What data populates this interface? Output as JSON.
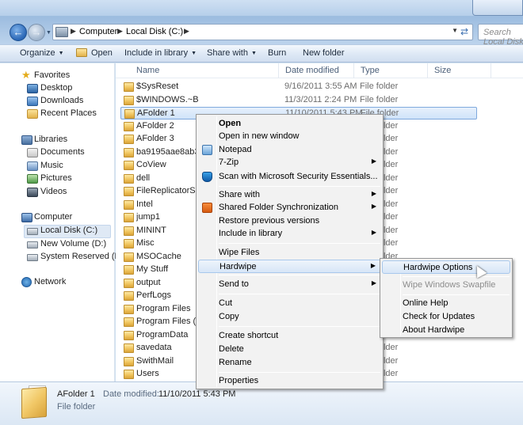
{
  "nav": {
    "address_segments": [
      "Computer",
      "Local Disk (C:)"
    ],
    "search_placeholder": "Search Local Disk (C:)"
  },
  "toolbar": {
    "organize": "Organize",
    "open": "Open",
    "include": "Include in library",
    "share": "Share with",
    "burn": "Burn",
    "new_folder": "New folder"
  },
  "sidebar": {
    "favorites": "Favorites",
    "desktop": "Desktop",
    "downloads": "Downloads",
    "recent": "Recent Places",
    "libraries": "Libraries",
    "documents": "Documents",
    "music": "Music",
    "pictures": "Pictures",
    "videos": "Videos",
    "computer": "Computer",
    "local_disk": "Local Disk (C:)",
    "new_volume": "New Volume (D:)",
    "system_reserved": "System Reserved (E:)",
    "network": "Network"
  },
  "columns": {
    "name": "Name",
    "date": "Date modified",
    "type": "Type",
    "size": "Size"
  },
  "files": [
    {
      "name": "$SysReset",
      "date": "9/16/2011 3:55 AM",
      "type": "File folder"
    },
    {
      "name": "$WINDOWS.~BT",
      "date": "11/3/2011 2:24 PM",
      "type": "File folder"
    },
    {
      "name": "AFolder 1",
      "date": "11/10/2011 5:43 PM",
      "type": "File folder"
    },
    {
      "name": "AFolder 2",
      "date": "",
      "type": "File folder"
    },
    {
      "name": "AFolder 3",
      "date": "",
      "type": "File folder"
    },
    {
      "name": "ba9195aae8ab38be",
      "date": "",
      "type": "File folder"
    },
    {
      "name": "CoView",
      "date": "",
      "type": "File folder"
    },
    {
      "name": "dell",
      "date": "",
      "type": "File folder"
    },
    {
      "name": "FileReplicatorService",
      "date": "",
      "type": "File folder"
    },
    {
      "name": "Intel",
      "date": "",
      "type": "File folder"
    },
    {
      "name": "jump1",
      "date": "",
      "type": "File folder"
    },
    {
      "name": "MININT",
      "date": "",
      "type": "File folder"
    },
    {
      "name": "Misc",
      "date": "",
      "type": "File folder"
    },
    {
      "name": "MSOCache",
      "date": "",
      "type": "File folder"
    },
    {
      "name": "My Stuff",
      "date": "",
      "type": "File folder"
    },
    {
      "name": "output",
      "date": "",
      "type": "File folder"
    },
    {
      "name": "PerfLogs",
      "date": "",
      "type": "File folder"
    },
    {
      "name": "Program Files",
      "date": "",
      "type": "File folder"
    },
    {
      "name": "Program Files (x86)",
      "date": "",
      "type": "File folder"
    },
    {
      "name": "ProgramData",
      "date": "",
      "type": "File folder"
    },
    {
      "name": "savedata",
      "date": "",
      "type": "File folder"
    },
    {
      "name": "SwithMail",
      "date": "",
      "type": "File folder"
    },
    {
      "name": "Users",
      "date": "",
      "type": "File folder"
    }
  ],
  "context_menu": {
    "open": "Open",
    "open_new_window": "Open in new window",
    "notepad": "Notepad",
    "seven_zip": "7-Zip",
    "scan_mse": "Scan with Microsoft Security Essentials...",
    "share_with": "Share with",
    "shared_folder_sync": "Shared Folder Synchronization",
    "restore_versions": "Restore previous versions",
    "include_library": "Include in library",
    "wipe_files": "Wipe Files",
    "hardwipe": "Hardwipe",
    "send_to": "Send to",
    "cut": "Cut",
    "copy": "Copy",
    "create_shortcut": "Create shortcut",
    "delete": "Delete",
    "rename": "Rename",
    "properties": "Properties"
  },
  "submenu": {
    "options": "Hardwipe Options",
    "swapfile": "Wipe Windows Swapfile",
    "help": "Online Help",
    "updates": "Check for Updates",
    "about": "About Hardwipe"
  },
  "details": {
    "name": "AFolder 1",
    "modified_label": "Date modified:",
    "modified_value": "11/10/2011 5:43 PM",
    "type": "File folder"
  }
}
